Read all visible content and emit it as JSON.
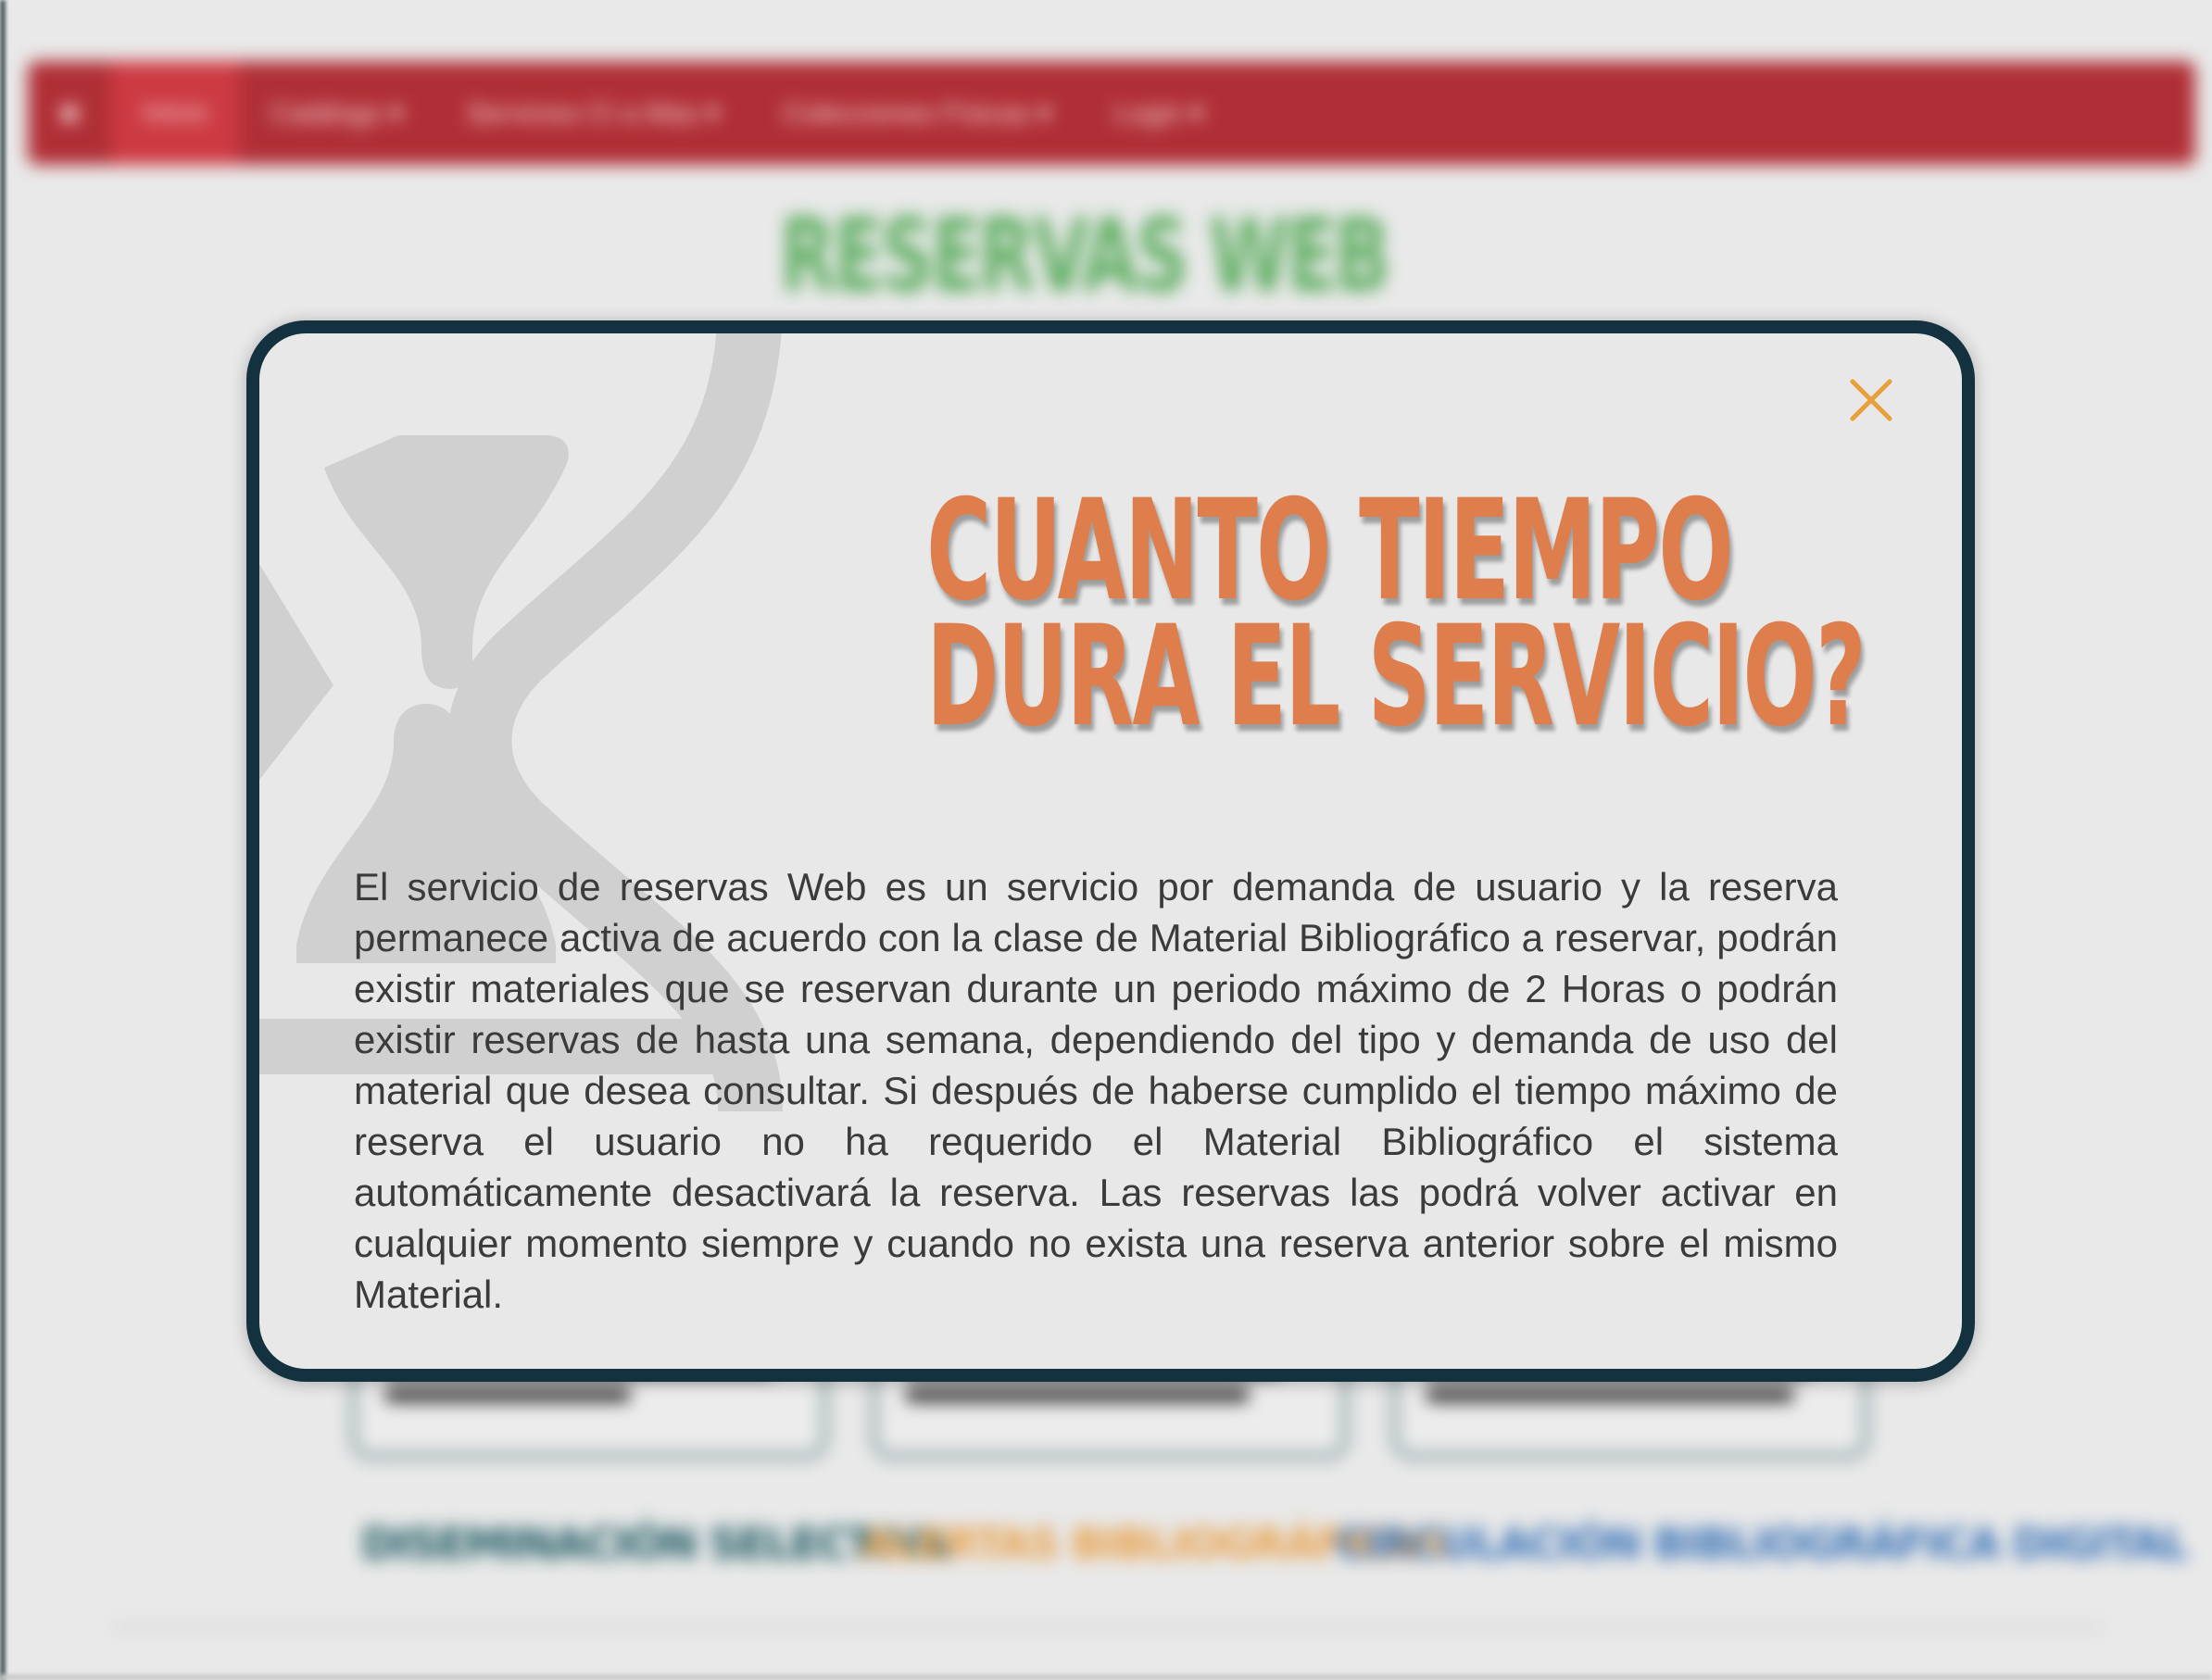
{
  "background": {
    "nav": {
      "home_icon": "home-icon",
      "items": [
        {
          "label": "Inicio",
          "active": true
        },
        {
          "label": "Catálogo ▾",
          "active": false
        },
        {
          "label": "Servicios CI a Mas ▾",
          "active": false
        },
        {
          "label": "Colecciones Físicas ▾",
          "active": false
        },
        {
          "label": "Login ▾",
          "active": false
        }
      ]
    },
    "title": "RESERVAS WEB",
    "links": [
      {
        "label": "DISEMINACIÓN SELECTIVA",
        "color": "#1f5b63"
      },
      {
        "label": "ALERTAS BIBLIOGRÁFICAS",
        "color": "#e8a04a"
      },
      {
        "label": "CIRCULACIÓN BIBLIOGRÁFICA DIGITAL",
        "color": "#3b74b8"
      }
    ]
  },
  "modal": {
    "close_label": "×",
    "heading_line1": "CUANTO TIEMPO",
    "heading_line2": "DURA EL SERVICIO?",
    "body": "El servicio de reservas Web es un servicio por demanda de usuario y la reserva permanece activa de acuerdo con la clase de Material Bibliográfico a reservar, podrán existir materiales que se reservan durante un periodo máximo de 2 Horas o podrán existir reservas de hasta una semana, dependiendo del tipo y demanda de uso del material que desea consultar. Si después de haberse cumplido el tiempo máximo de reserva el usuario no ha requerido el Material Bibliográfico el sistema automáticamente desactivará la reserva. Las reservas las podrá volver activar en cualquier momento siempre y cuando no exista una reserva anterior sobre el mismo Material."
  },
  "colors": {
    "nav_bg": "#b02f36",
    "title_green": "#5fae62",
    "modal_border": "#13313f",
    "heading_orange": "#dd7e4c",
    "close_orange": "#e8a03a"
  },
  "icons": [
    "home-icon",
    "hourglass-icon",
    "close-icon"
  ]
}
